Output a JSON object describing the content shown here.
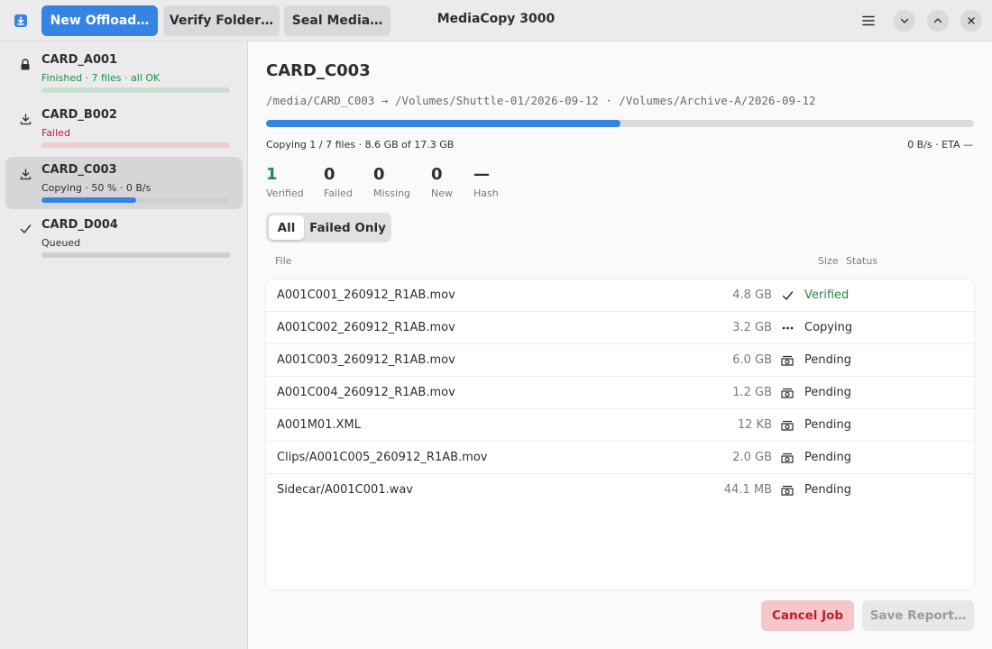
{
  "app": {
    "title": "MediaCopy 3000"
  },
  "header": {
    "offload_icon": "download-icon",
    "new_offload_label": "New Offload…",
    "verify_folder_label": "Verify Folder…",
    "seal_media_label": "Seal Media…",
    "menu_icon": "hamburger-menu-icon",
    "window_controls": [
      "minimize",
      "maximize",
      "close"
    ]
  },
  "sidebar": {
    "cards": [
      {
        "name": "CARD_A001",
        "icon": "lock-icon",
        "status": "Finished · 7 files · all OK",
        "state": "ok",
        "progress": 1.0
      },
      {
        "name": "CARD_B002",
        "icon": "download-icon",
        "status": "Failed",
        "state": "fail",
        "progress": 1.0
      },
      {
        "name": "CARD_C003",
        "icon": "download-icon",
        "status": "Copying · 50 % · 0 B/s",
        "state": "active",
        "progress": 0.5,
        "selected": true
      },
      {
        "name": "CARD_D004",
        "icon": "check-icon",
        "status": "Queued",
        "state": "queued",
        "progress": 0.0
      }
    ]
  },
  "job": {
    "title": "CARD_C003",
    "path": "/media/CARD_C003 → /Volumes/Shuttle-01/2026-09-12 · /Volumes/Archive-A/2026-09-12",
    "progress": 0.5,
    "progress_text": "Copying 1 / 7 files · 8.6 GB of 17.3 GB",
    "speed_text": "0 B/s · ETA —"
  },
  "stats": [
    {
      "value": "1",
      "label": "Verified",
      "state": "ok"
    },
    {
      "value": "0",
      "label": "Failed",
      "state": ""
    },
    {
      "value": "0",
      "label": "Missing",
      "state": ""
    },
    {
      "value": "0",
      "label": "New",
      "state": ""
    },
    {
      "value": "—",
      "label": "Hash",
      "state": ""
    }
  ],
  "filter": {
    "all_label": "All",
    "failed_only_label": "Failed Only",
    "selected": "All"
  },
  "columns": {
    "file": "File",
    "size": "Size",
    "status": "Status"
  },
  "files": [
    {
      "name": "A001C001_260912_R1AB.mov",
      "size": "4.8 GB",
      "status": "Verified",
      "icon": "check-icon",
      "state": "ok"
    },
    {
      "name": "A001C002_260912_R1AB.mov",
      "size": "3.2 GB",
      "status": "Copying",
      "icon": "ellipsis-icon",
      "state": "copying"
    },
    {
      "name": "A001C003_260912_R1AB.mov",
      "size": "6.0 GB",
      "status": "Pending",
      "icon": "drive-icon",
      "state": "pending"
    },
    {
      "name": "A001C004_260912_R1AB.mov",
      "size": "1.2 GB",
      "status": "Pending",
      "icon": "drive-icon",
      "state": "pending"
    },
    {
      "name": "A001M01.XML",
      "size": "12 KB",
      "status": "Pending",
      "icon": "drive-icon",
      "state": "pending"
    },
    {
      "name": "Clips/A001C005_260912_R1AB.mov",
      "size": "2.0 GB",
      "status": "Pending",
      "icon": "drive-icon",
      "state": "pending"
    },
    {
      "name": "Sidecar/A001C001.wav",
      "size": "44.1 MB",
      "status": "Pending",
      "icon": "drive-icon",
      "state": "pending"
    }
  ],
  "footer": {
    "cancel_label": "Cancel Job",
    "save_label": "Save Report…"
  },
  "colors": {
    "accent": "#3584e4",
    "success": "#26894a",
    "error": "#c01c28"
  }
}
